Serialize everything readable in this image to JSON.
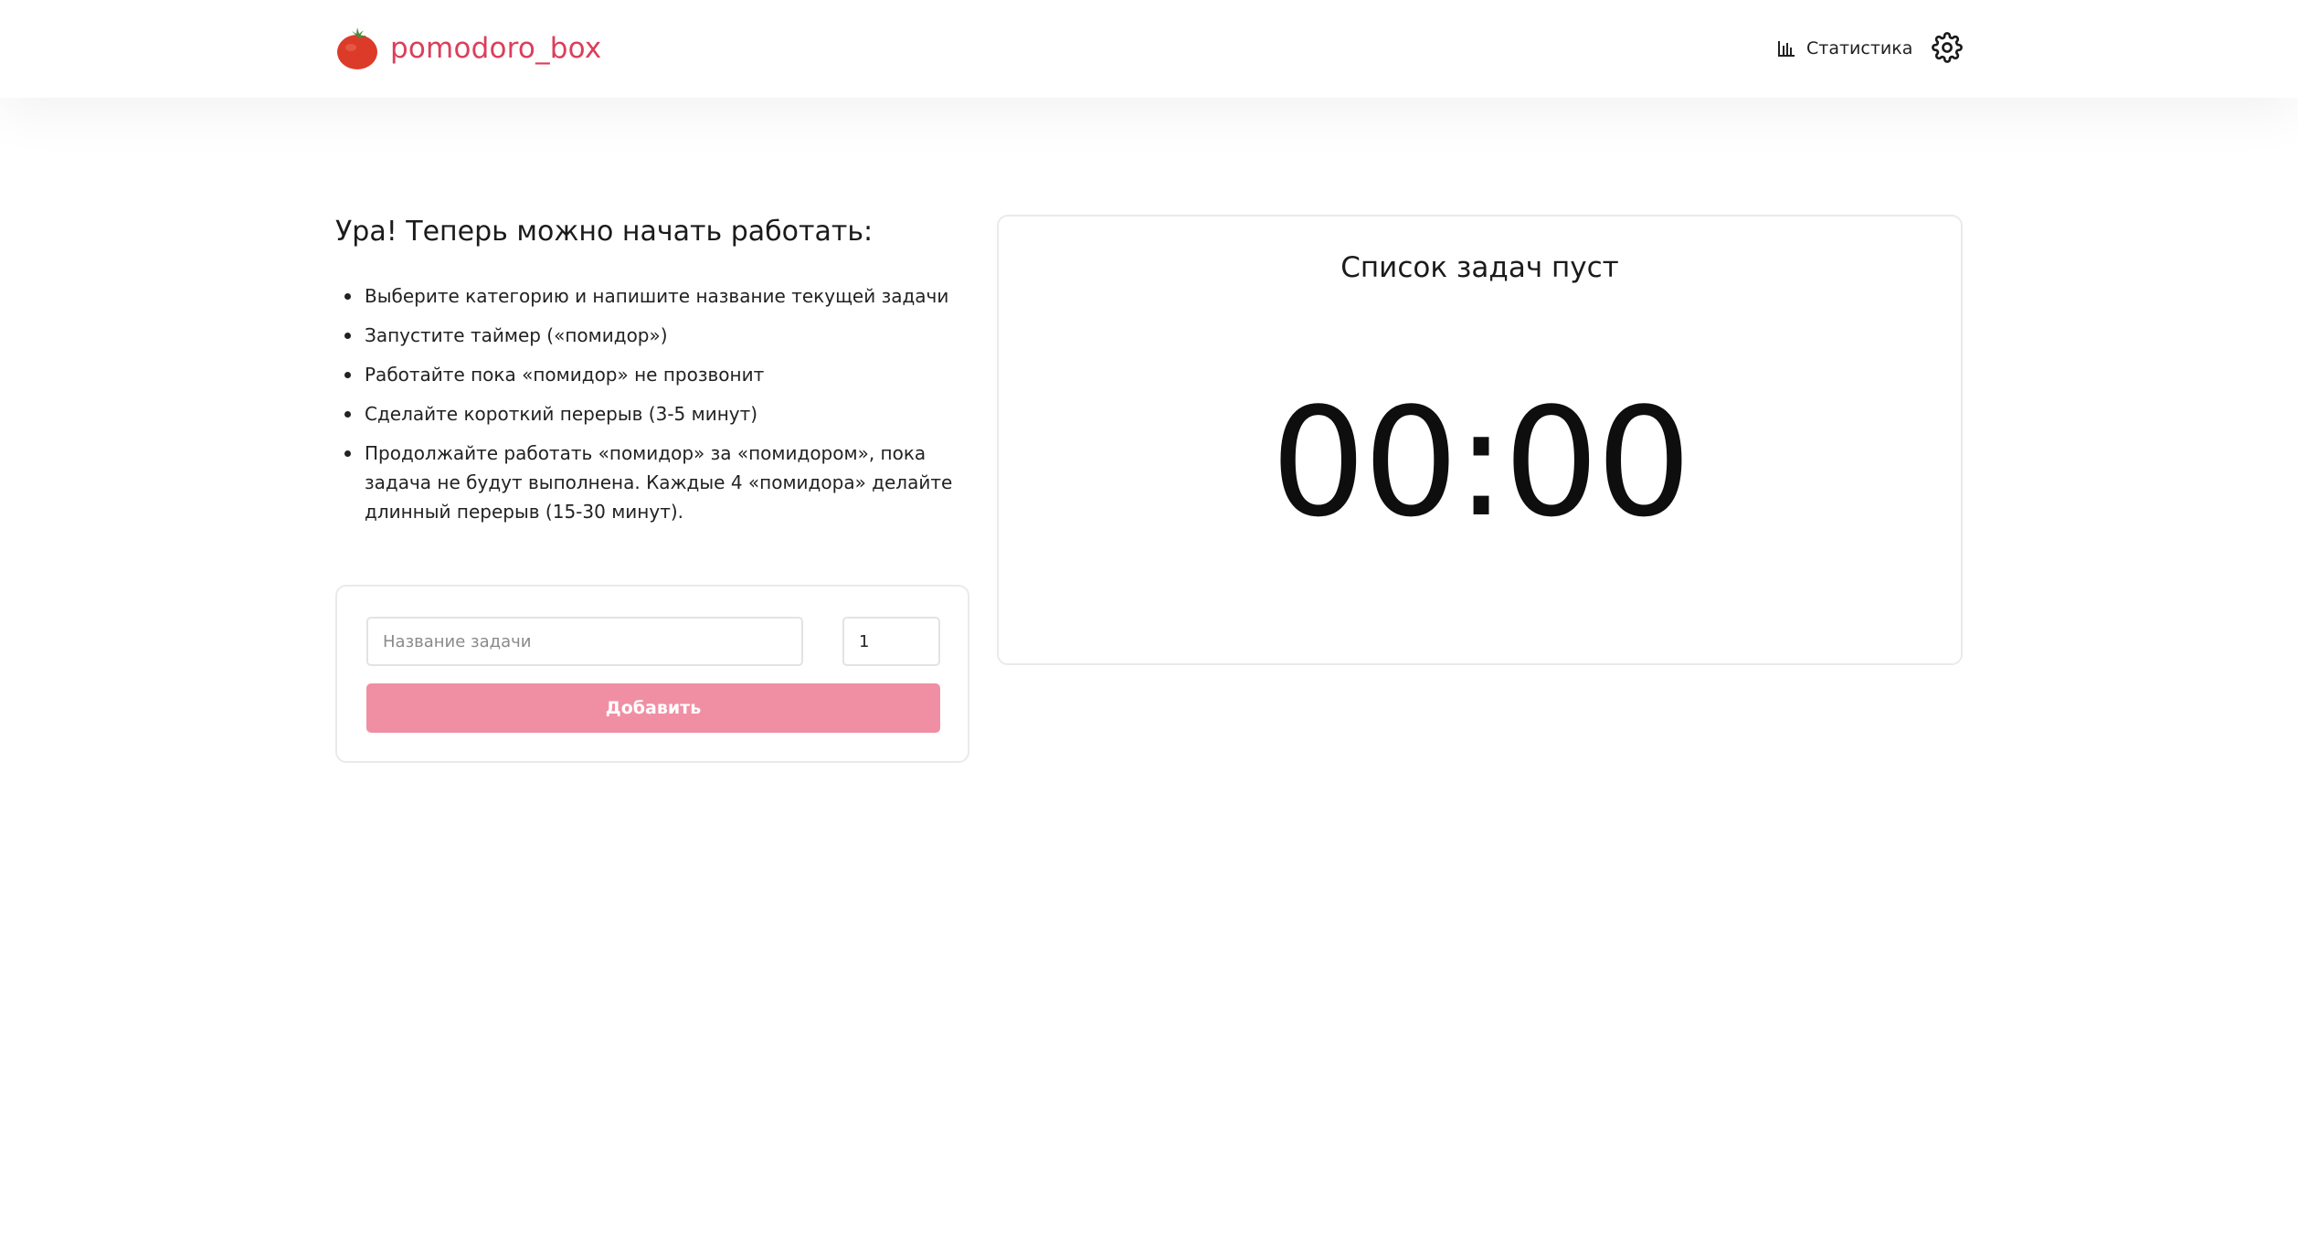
{
  "header": {
    "logo_text": "pomodoro_box",
    "stats_label": "Статистика",
    "icons": {
      "logo": "tomato-icon",
      "stats": "bar-chart-icon",
      "settings": "gear-icon"
    }
  },
  "intro": {
    "title": "Ура! Теперь можно начать работать:",
    "steps": [
      "Выберите категорию и напишите название текущей задачи",
      "Запустите таймер («помидор»)",
      "Работайте пока «помидор» не прозвонит",
      "Сделайте короткий перерыв (3-5 минут)",
      "Продолжайте работать «помидор» за «помидором», пока задача не будут выполнена. Каждые 4 «помидора» делайте длинный перерыв (15-30 минут)."
    ]
  },
  "add_task": {
    "name_placeholder": "Название задачи",
    "name_value": "",
    "count_value": "1",
    "button_label": "Добавить"
  },
  "timer_panel": {
    "empty_title": "Список задач пуст",
    "time": "00:00"
  },
  "colors": {
    "brand": "#dc3e5a",
    "button_disabled": "#f08fa3",
    "border": "#eaeaea"
  }
}
